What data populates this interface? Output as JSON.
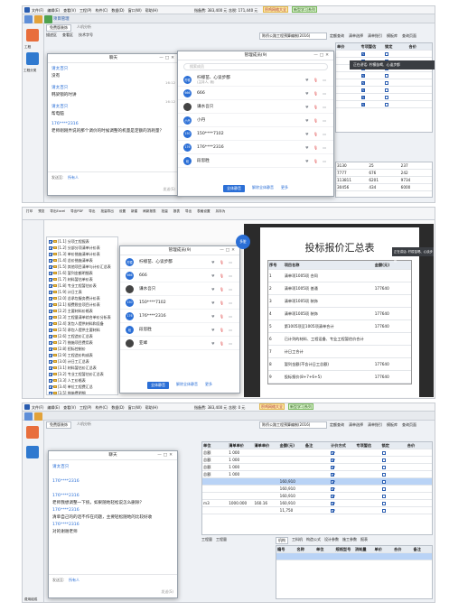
{
  "panel1": {
    "menu": [
      "文件(F)",
      "编辑(E)",
      "查看(V)",
      "工程(P)",
      "构件(C)",
      "数据(D)",
      "窗口(W)",
      "帮助(H)"
    ],
    "price_info": "指备费: 383,400 元",
    "price_info2": "含税: 171,440 元",
    "highlight": "积鸡网络大全",
    "highlight2": "新型学习系列",
    "toolbar_label": "项目管理",
    "tabs": [
      "免费版装饰",
      "人机分析"
    ],
    "subtabs": [
      "描述区",
      "查看区",
      "技术字号"
    ],
    "left_items": [
      "工程",
      "工程分类"
    ],
    "group_select": "陈桥公路工程预算编制(2016)",
    "right_tabs": [
      "定额查询",
      "清单选择",
      "清单指引",
      "模板库",
      "查询页面"
    ],
    "chat": {
      "title": "聊天",
      "messages": [
        {
          "name": "请太百只",
          "text": "没有",
          "time": "16:12"
        },
        {
          "name": "请太百只",
          "text": "韩梁锁的时讲",
          "time": "16:12"
        },
        {
          "name": "请太百只",
          "text": "帮电脑",
          "time": ""
        },
        {
          "name": "176****2316",
          "text": "老师刚刚弄说的那个调价的时候调整的机量是定额的消耗量？",
          "time": ""
        }
      ],
      "sender_label": "发送至:",
      "sender_value": "所有人",
      "send_button": "发送(S)"
    },
    "members": {
      "title": "管理成员(9)",
      "search": "搜索成员",
      "list": [
        {
          "avatar": "柠檬",
          "name": "柠檬苗、心谈步都",
          "sub": "(主持人, 我)"
        },
        {
          "avatar": "666",
          "name": "666",
          "sub": ""
        },
        {
          "avatar": "",
          "name": "谦水吾只",
          "sub": ""
        },
        {
          "avatar": "小丹",
          "name": "小丹",
          "sub": ""
        },
        {
          "avatar": "150",
          "name": "150****7102",
          "sub": ""
        },
        {
          "avatar": "176",
          "name": "176****2316",
          "sub": ""
        },
        {
          "avatar": "段",
          "name": "段思胜",
          "sub": ""
        }
      ],
      "mute_all": "全体静音",
      "unmute_all": "解除全体静音",
      "more": "更多"
    },
    "notice": "正在讲话: 柠檬苗喝、心谈步都",
    "right_grid_headers": [
      "单价",
      "专项暂估",
      "锁定",
      "合价"
    ],
    "right_values": [
      "3130",
      "7777",
      "113811",
      "30456"
    ],
    "right_values2": [
      "25",
      "676",
      "6201",
      "434"
    ],
    "right_values3": [
      "237",
      "242",
      "9734",
      "6000"
    ]
  },
  "panel2": {
    "toolbar": [
      "打印",
      "预览",
      "导出Excel",
      "导出PDF",
      "导出",
      "批量导出",
      "设置",
      "新建",
      "刷新报表",
      "批量",
      "报表",
      "导出",
      "表格设置",
      "另存为"
    ],
    "title": "投标报价汇总表",
    "tree": [
      "[1.1] 分项工程报表",
      "[1.2] 分部分项清单计价表",
      "[1.3] 单价措施清单计价表",
      "[1.4] 总价措施清单表",
      "[1.5] 其他项目清单与计价汇总表",
      "[1.6] 暂列金额明细表",
      "[1.7] 材料暂估单价表",
      "[1.8] 专业工程暂估价表",
      "[1.9] 计日工表",
      "[2.0] 总承包服务费计价表",
      "[2.1] 规费税金项目计价表",
      "[2.2] 主要材料价格表",
      "[2.3] 工程量清单综合单价分析表",
      "[2.4] 发包人提供材料和设备",
      "[2.5] 承包人提供主要材料",
      "[2.6] 工程造价汇总表",
      "[2.7] 措施项目费用表",
      "[2.8] 招标控制价",
      "[2.9] 工程造价构成表",
      "[3.0] 计日工汇总表",
      "[3.1] 材料暂估价汇总表",
      "[3.2] 专业工程暂估价汇总表",
      "[3.3] 人工价格表",
      "[3.4] 单位工程费汇总",
      "[3.5] 措施费明细",
      "[3.6] 单项工程费汇总表",
      "[3.7] 建设项目费汇总",
      "[3.8] 其他费用汇总"
    ],
    "members_title": "管理成员(9)",
    "members": [
      {
        "avatar": "柠檬",
        "name": "柠檬苗、心谈步都",
        "sub": "(主持人, 我)"
      },
      {
        "avatar": "666",
        "name": "666",
        "sub": ""
      },
      {
        "avatar": "",
        "name": "谦水吾只",
        "sub": ""
      },
      {
        "avatar": "150",
        "name": "150****7102",
        "sub": ""
      },
      {
        "avatar": "176",
        "name": "176****2316",
        "sub": ""
      },
      {
        "avatar": "段",
        "name": "段思胜",
        "sub": ""
      },
      {
        "avatar": "",
        "name": "亚峰",
        "sub": ""
      }
    ],
    "mute_all": "全体静音",
    "unmute_all": "解除全体静音",
    "more": "更多",
    "report_headers": [
      "序号",
      "项目名称",
      "金额(元)"
    ],
    "report_rows": [
      [
        "1",
        "清单项1005项 合同",
        ""
      ],
      [
        "2",
        "清单项1005项 普通",
        "177640"
      ],
      [
        "3",
        "清单项1005项 装饰",
        ""
      ],
      [
        "4",
        "清单项1005项 装饰",
        "177640"
      ],
      [
        "5",
        "第1005项至1005项清单合计",
        "177640"
      ],
      [
        "6",
        "已计列的材料、工程设备、专业工程暂估价合计",
        ""
      ],
      [
        "7",
        "计日工合计",
        ""
      ],
      [
        "8",
        "暂列金额(不含计日工总额)",
        "177640"
      ],
      [
        "9",
        "投标报价(8+7+6+5)",
        "177640"
      ]
    ],
    "notice": "正在讲话: 柠檬苗喝、心谈步都"
  },
  "panel3": {
    "menu": [
      "文件(F)",
      "编辑(E)",
      "查看(V)",
      "工程(P)",
      "构件(C)",
      "数据(D)",
      "窗口(W)",
      "帮助(H)"
    ],
    "price_info": "指备费: 383,400 元",
    "price_info2": "含税: 0 元",
    "highlight": "积鸡网络大全",
    "highlight2": "新型学习系列",
    "tabs": [
      "免费版装饰",
      "人机分析"
    ],
    "group_select": "陈桥公路工程预算编制(2016)",
    "right_tabs": [
      "定额查询",
      "清单选择",
      "清单指引",
      "模板库",
      "查询页面"
    ],
    "chat": {
      "title": "聊天",
      "messages": [
        {
          "name": "请太百只",
          "text": "",
          "time": ""
        },
        {
          "name": "176****2316",
          "text": "",
          "time": ""
        },
        {
          "name": "176****2316",
          "text": "老师我想调整一下统，如果随地轻松说怎么删除？",
          "time": ""
        },
        {
          "name": "176****2316",
          "text": "清单自己的的话不作在问题，主要轻松随地的比较好收",
          "time": ""
        },
        {
          "name": "176****2316",
          "text": "对的谢谢老师",
          "time": ""
        }
      ],
      "sender_label": "发送至:",
      "sender_value": "所有人",
      "send_button": "发送(S)"
    },
    "grid_headers": [
      "单位",
      "清单单价",
      "清单单价",
      "金额(元)",
      "备注",
      "计价方式",
      "专项暂估",
      "锁定",
      "合价"
    ],
    "grid_rows": [
      [
        "总额",
        "1 000",
        "",
        "",
        "",
        "",
        "",
        "",
        ""
      ],
      [
        "总额",
        "1 000",
        "",
        "",
        "",
        "",
        "",
        "",
        ""
      ],
      [
        "总额",
        "1 000",
        "",
        "",
        "",
        "",
        "",
        "",
        ""
      ],
      [
        "总额",
        "1 000",
        "",
        "",
        "",
        "",
        "",
        "",
        ""
      ],
      [
        "",
        "",
        "",
        "160,910",
        "",
        "",
        "",
        "",
        ""
      ],
      [
        "",
        "",
        "",
        "160,910",
        "",
        "",
        "",
        "",
        ""
      ],
      [
        "",
        "",
        "",
        "160,910",
        "",
        "",
        "",
        "",
        ""
      ],
      [
        "m3",
        "1000.000",
        "160.16",
        "160,910",
        "",
        "",
        "",
        "",
        ""
      ],
      [
        "",
        "",
        "",
        "11,750",
        "",
        "",
        "",
        "",
        ""
      ]
    ],
    "bottom_tabs": [
      "工程量",
      "工程量",
      "工程量"
    ],
    "bottom_right_tabs": [
      "机构",
      "工料机",
      "构造公式",
      "设计参数",
      "施工参数",
      "报表"
    ],
    "bottom_grid_headers": [
      "编号",
      "名称",
      "单位",
      "规格型号",
      "消耗量",
      "单价",
      "合价",
      "备注"
    ],
    "bottom_row": [
      "",
      "",
      "",
      "",
      "",
      "",
      "",
      ""
    ],
    "bottom_label": "费用组成"
  }
}
